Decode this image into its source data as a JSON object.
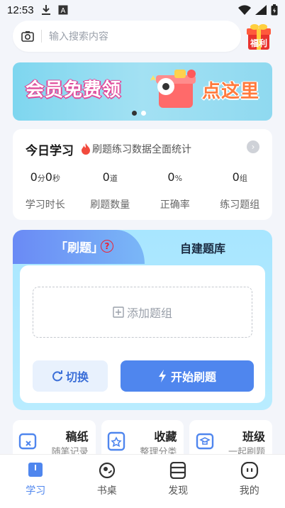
{
  "status_bar": {
    "time": "12:53"
  },
  "search": {
    "placeholder": "输入搜索内容",
    "gift_label": "福利"
  },
  "banner": {
    "left_text": "会员免费领",
    "right_text": "点这里"
  },
  "study": {
    "title": "今日学习",
    "subtitle": "刷题练习数据全面统计",
    "stats": [
      {
        "value_parts": [
          "0",
          "分",
          "0",
          "秒"
        ],
        "label": "学习时长"
      },
      {
        "value": "0",
        "unit": "道",
        "label": "刷题数量"
      },
      {
        "value": "0",
        "unit": "%",
        "label": "正确率"
      },
      {
        "value": "0",
        "unit": "组",
        "label": "练习题组"
      }
    ]
  },
  "practice": {
    "tab_active": "「刷题」",
    "tab_inactive": "自建题库",
    "add_group": "添加题组",
    "switch_label": "切换",
    "start_label": "开始刷题"
  },
  "tools": [
    {
      "title": "稿纸",
      "sub": "随笔记录"
    },
    {
      "title": "收藏",
      "sub": "整理分类"
    },
    {
      "title": "班级",
      "sub": "一起刷题"
    }
  ],
  "nav": [
    {
      "label": "学习",
      "active": true
    },
    {
      "label": "书桌",
      "active": false
    },
    {
      "label": "发现",
      "active": false
    },
    {
      "label": "我的",
      "active": false
    }
  ],
  "colors": {
    "accent": "#4f86ee",
    "tab_gradient_start": "#6a8af5",
    "practice_bg": "#a8e6ff"
  }
}
